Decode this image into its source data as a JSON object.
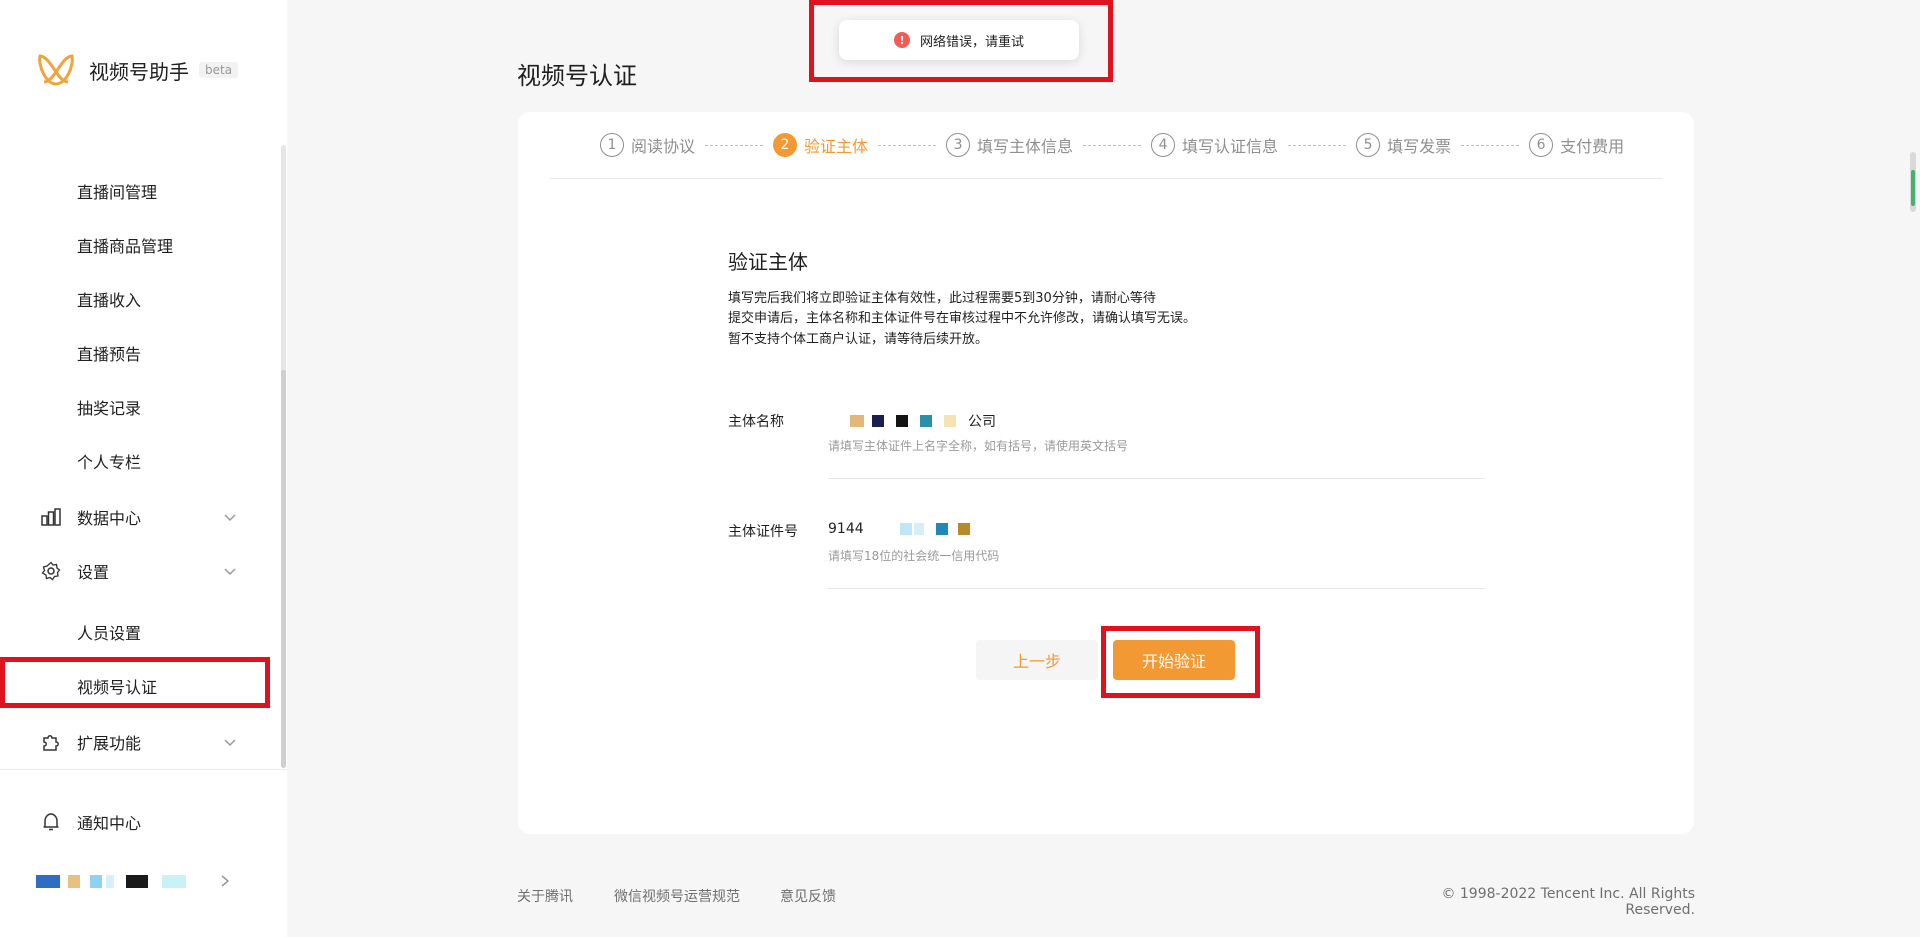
{
  "app": {
    "name": "视频号助手",
    "badge": "beta"
  },
  "sidebar": {
    "items": [
      {
        "label": "直播间管理"
      },
      {
        "label": "直播商品管理"
      },
      {
        "label": "直播收入"
      },
      {
        "label": "直播预告"
      },
      {
        "label": "抽奖记录"
      },
      {
        "label": "个人专栏"
      }
    ],
    "groups": {
      "data_center": "数据中心",
      "settings": "设置",
      "staff_settings": "人员设置",
      "channel_cert": "视频号认证",
      "extensions": "扩展功能"
    },
    "notification_center": "通知中心"
  },
  "page": {
    "title": "视频号认证"
  },
  "steps": [
    {
      "num": "1",
      "label": "阅读协议",
      "active": false
    },
    {
      "num": "2",
      "label": "验证主体",
      "active": true
    },
    {
      "num": "3",
      "label": "填写主体信息",
      "active": false
    },
    {
      "num": "4",
      "label": "填写认证信息",
      "active": false
    },
    {
      "num": "5",
      "label": "填写发票",
      "active": false
    },
    {
      "num": "6",
      "label": "支付费用",
      "active": false
    }
  ],
  "form": {
    "section_title": "验证主体",
    "desc_lines": [
      "填写完后我们将立即验证主体有效性，此过程需要5到30分钟，请耐心等待",
      "提交申请后，主体名称和主体证件号在审核过程中不允许修改，请确认填写无误。",
      "暂不支持个体工商户认证，请等待后续开放。"
    ],
    "entity_name": {
      "label": "主体名称",
      "value_suffix": "公司",
      "hint": "请填写主体证件上名字全称，如有括号，请使用英文括号"
    },
    "entity_id": {
      "label": "主体证件号",
      "value_prefix": "9144",
      "hint": "请填写18位的社会统一信用代码"
    },
    "buttons": {
      "prev": "上一步",
      "start": "开始验证"
    }
  },
  "toast": {
    "icon": "error-icon",
    "message": "网络错误，请重试"
  },
  "footer": {
    "links": [
      "关于腾讯",
      "微信视频号运营规范",
      "意见反馈"
    ],
    "copyright": "© 1998-2022 Tencent Inc. All Rights Reserved."
  },
  "colors": {
    "accent": "#f29934",
    "highlight": "#e0121d",
    "error": "#f25c54"
  }
}
